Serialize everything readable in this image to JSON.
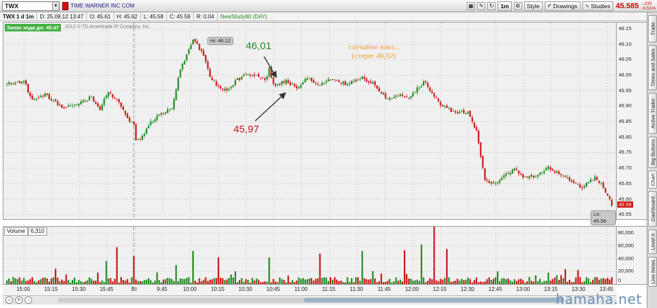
{
  "toolbar": {
    "symbol": "TWX",
    "company": "TIME WARNER INC COM",
    "interval_button": "1m",
    "style_label": "Style",
    "drawings_label": "Drawings",
    "studies_label": "Studies",
    "last_price": "45.585",
    "change_abs": "-.235",
    "change_pct": "-0.51%"
  },
  "infobar": {
    "symbol_period": "TWX 1 d 1m",
    "date": "D: 25.09.12 13:47",
    "open": "O: 45.61",
    "high": "H: 45.62",
    "low": "L: 45.58",
    "close": "C: 45.59",
    "range": "R: 0.04",
    "study": "NewStudy80 (DAY)"
  },
  "panel": {
    "banner": "Запас хода до: 45.47",
    "copyright": "2012 © TD Ameritrade IP Company, Inc.",
    "hi_label": "Hi: 46.12",
    "lo_label": "Lo: 45.58",
    "current_price": "45.59",
    "colors": {
      "up": "#1c8a1c",
      "down": "#c81414",
      "background": "#f0f0f0",
      "grid": "#c8c8c8"
    }
  },
  "annotations": {
    "green": "46,01",
    "red": "45,97",
    "orange_line1": "случайно взял...",
    "orange_line2": "(стерег 46,02)"
  },
  "volume": {
    "label": "Volume",
    "value": "6,310"
  },
  "side_tabs": [
    "Trade",
    "Times and Sales",
    "Active Trader",
    "Big Buttons",
    "Chart",
    "Dashboard",
    "Level II",
    "Live News"
  ],
  "watermark": "hamaha.net",
  "chart_data": {
    "type": "candlestick",
    "price_axis": {
      "ticks": [
        46.15,
        46.1,
        46.05,
        46.0,
        45.95,
        45.9,
        45.85,
        45.8,
        45.75,
        45.7,
        45.65,
        45.6,
        45.55
      ],
      "ylim": [
        45.535,
        46.17
      ]
    },
    "volume_axis": {
      "ticks": [
        80000,
        60000,
        40000,
        20000,
        0
      ],
      "tick_labels": [
        "80,000",
        "60,000",
        "40,000",
        "20,000",
        "0"
      ],
      "ylim": [
        0,
        90000
      ]
    },
    "time_ticks": [
      "15:00",
      "15:15",
      "15:30",
      "15:45",
      "Вт",
      "9:45",
      "10:00",
      "10:15",
      "10:30",
      "10:45",
      "11:00",
      "11:15",
      "11:30",
      "11:45",
      "12:00",
      "12:15",
      "12:30",
      "12:45",
      "13:00",
      "13:15",
      "13:30",
      "13:45"
    ],
    "path": [
      [
        0,
        45.97
      ],
      [
        8,
        45.98
      ],
      [
        12,
        45.92
      ],
      [
        18,
        45.94
      ],
      [
        26,
        45.895
      ],
      [
        34,
        45.905
      ],
      [
        40,
        45.93
      ],
      [
        44,
        45.89
      ],
      [
        48,
        45.95
      ],
      [
        54,
        45.9
      ],
      [
        58,
        45.85
      ],
      [
        60,
        45.84
      ],
      [
        61,
        45.79
      ],
      [
        64,
        45.8
      ],
      [
        68,
        45.85
      ],
      [
        74,
        45.88
      ],
      [
        78,
        45.89
      ],
      [
        82,
        46.02
      ],
      [
        88,
        46.11
      ],
      [
        92,
        46.08
      ],
      [
        96,
        46.0
      ],
      [
        100,
        45.96
      ],
      [
        104,
        45.95
      ],
      [
        108,
        45.98
      ],
      [
        112,
        46.0
      ],
      [
        118,
        46.0
      ],
      [
        122,
        45.98
      ],
      [
        124,
        46.02
      ],
      [
        126,
        45.97
      ],
      [
        132,
        45.98
      ],
      [
        138,
        45.96
      ],
      [
        142,
        45.99
      ],
      [
        148,
        45.97
      ],
      [
        154,
        45.99
      ],
      [
        160,
        45.97
      ],
      [
        168,
        45.99
      ],
      [
        172,
        45.98
      ],
      [
        176,
        45.95
      ],
      [
        180,
        45.92
      ],
      [
        186,
        45.94
      ],
      [
        190,
        45.92
      ],
      [
        194,
        45.96
      ],
      [
        198,
        45.98
      ],
      [
        200,
        45.95
      ],
      [
        206,
        45.9
      ],
      [
        212,
        45.88
      ],
      [
        218,
        45.88
      ],
      [
        222,
        45.82
      ],
      [
        226,
        45.66
      ],
      [
        232,
        45.65
      ],
      [
        236,
        45.68
      ],
      [
        240,
        45.7
      ],
      [
        244,
        45.67
      ],
      [
        250,
        45.67
      ],
      [
        256,
        45.7
      ],
      [
        262,
        45.68
      ],
      [
        266,
        45.66
      ],
      [
        272,
        45.64
      ],
      [
        278,
        45.67
      ],
      [
        282,
        45.64
      ],
      [
        286,
        45.58
      ]
    ],
    "volume_spikes": [
      [
        47,
        36000
      ],
      [
        52,
        58000
      ],
      [
        60,
        44000
      ],
      [
        80,
        30000
      ],
      [
        88,
        52000
      ],
      [
        100,
        42000
      ],
      [
        124,
        42000
      ],
      [
        148,
        48000
      ],
      [
        168,
        52000
      ],
      [
        188,
        53000
      ],
      [
        196,
        62000
      ],
      [
        202,
        82000
      ],
      [
        208,
        55000
      ],
      [
        232,
        20000
      ],
      [
        256,
        18000
      ],
      [
        270,
        22000
      ]
    ],
    "volume_base": 8000
  }
}
